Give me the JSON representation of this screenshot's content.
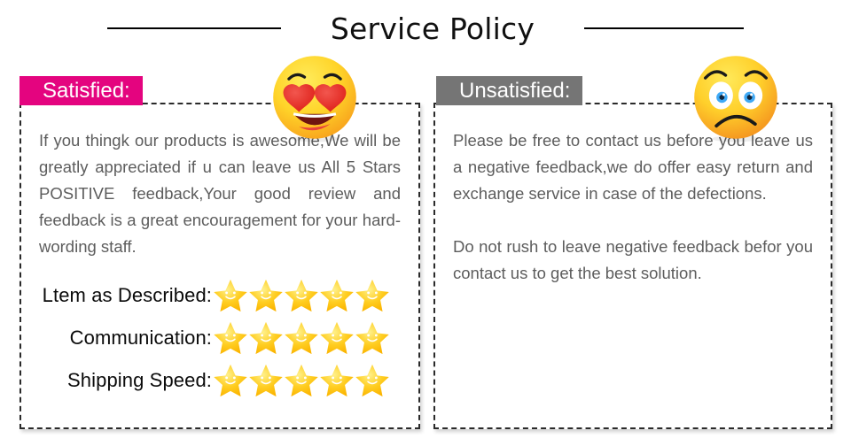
{
  "header": {
    "title": "Service Policy",
    "rule_left": "horizontal-rule",
    "rule_right": "horizontal-rule"
  },
  "colors": {
    "satisfied_badge_bg": "#E4047F",
    "unsatisfied_badge_bg": "#757575",
    "badge_text": "#FFFFFF",
    "body_text": "#5D5D5D",
    "label_text": "#0B0B0B",
    "panel_border": "#2A2A2A",
    "star_gold": "#FFC107",
    "emoji_yellow": "#FFD93B",
    "heart_red": "#E8302A",
    "eye_blue": "#3FA9F5",
    "page_background": "#FFFFFF"
  },
  "left_panel": {
    "badge_label": "Satisfied:",
    "emoji_name": "heart-eyes-emoji",
    "paragraphs": [
      "If you thingk our products is awesome,We will be greatly appreciated if u can leave us All 5 Stars POSITIVE feedback,Your good review and feedback is a great encouragement for your hard-wording staff."
    ],
    "ratings": [
      {
        "label": "Ltem as Described:",
        "stars": 5
      },
      {
        "label": "Communication:",
        "stars": 5
      },
      {
        "label": "Shipping Speed:",
        "stars": 5
      }
    ]
  },
  "right_panel": {
    "badge_label": "Unsatisfied:",
    "emoji_name": "sad-face-emoji",
    "paragraphs": [
      "Please be free to contact us before you leave us a negative feedback,we do offer easy return and exchange service in case of the defections.",
      "Do not rush to leave negative feedback befor you contact us to get the best solution."
    ]
  }
}
